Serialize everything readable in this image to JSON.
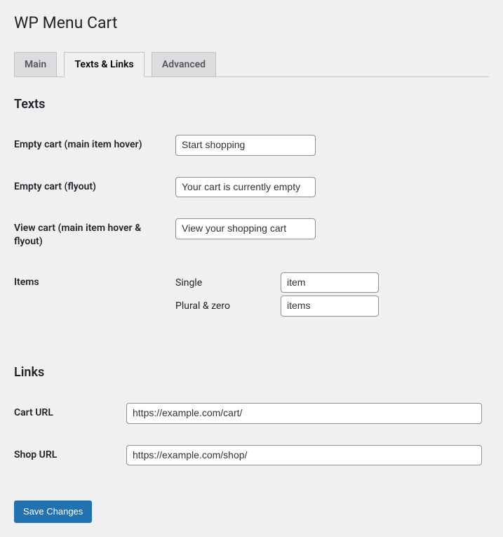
{
  "page_title": "WP Menu Cart",
  "tabs": {
    "main": "Main",
    "texts_links": "Texts & Links",
    "advanced": "Advanced"
  },
  "sections": {
    "texts": {
      "title": "Texts",
      "fields": {
        "empty_cart_hover": {
          "label": "Empty cart (main item hover)",
          "value": "Start shopping"
        },
        "empty_cart_flyout": {
          "label": "Empty cart (flyout)",
          "value": "Your cart is currently empty"
        },
        "view_cart": {
          "label": "View cart (main item hover & flyout)",
          "value": "View your shopping cart"
        },
        "items": {
          "label": "Items",
          "single_label": "Single",
          "single_value": "item",
          "plural_label": "Plural & zero",
          "plural_value": "items"
        }
      }
    },
    "links": {
      "title": "Links",
      "fields": {
        "cart_url": {
          "label": "Cart URL",
          "value": "https://example.com/cart/"
        },
        "shop_url": {
          "label": "Shop URL",
          "value": "https://example.com/shop/"
        }
      }
    }
  },
  "save_button": "Save Changes"
}
